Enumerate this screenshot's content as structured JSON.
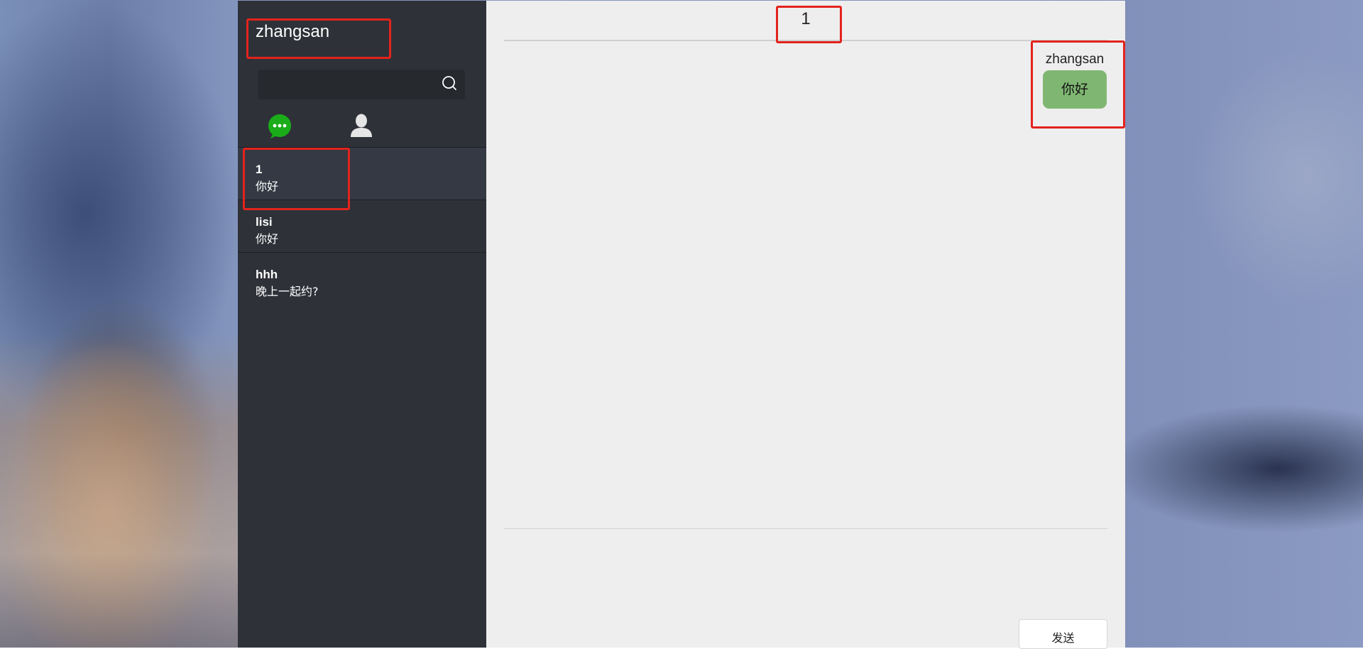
{
  "sidebar": {
    "user_name": "zhangsan",
    "search": {
      "placeholder": "",
      "value": ""
    },
    "nav": {
      "chat_icon": "chat-bubble-icon",
      "contacts_icon": "person-icon",
      "active": "chat"
    },
    "sessions": [
      {
        "name": "1",
        "last_message": "你好",
        "active": true
      },
      {
        "name": "lisi",
        "last_message": "你好",
        "active": false
      },
      {
        "name": "hhh",
        "last_message": "晚上一起约?",
        "active": false
      }
    ]
  },
  "chat": {
    "title": "1",
    "messages": [
      {
        "sender": "zhangsan",
        "text": "你好",
        "side": "right"
      }
    ],
    "input": {
      "value": ""
    },
    "send_label": "发送"
  },
  "colors": {
    "sidebar_bg": "#2e3138",
    "chat_bg": "#eeeeee",
    "bubble": "#7fb772",
    "chat_icon_green": "#1aad19",
    "annotation_red": "#e3231c"
  }
}
